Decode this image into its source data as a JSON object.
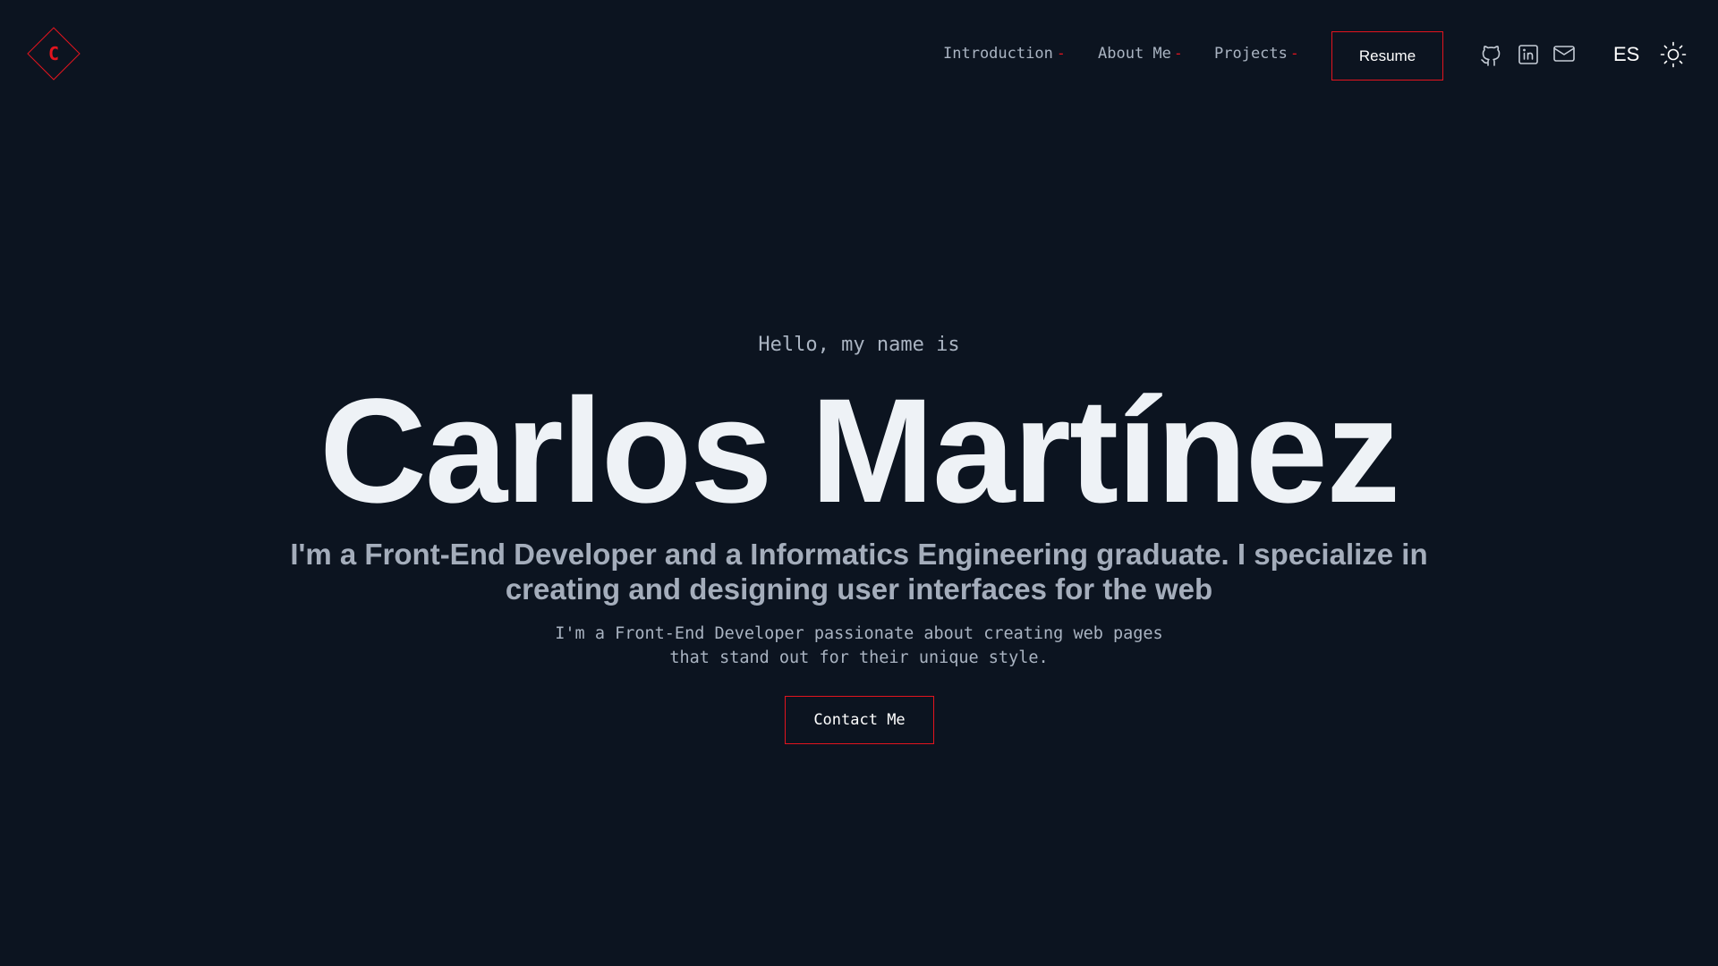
{
  "header": {
    "logo_letter": "C",
    "nav": [
      {
        "label": "Introduction"
      },
      {
        "label": "About Me"
      },
      {
        "label": "Projects"
      }
    ],
    "separator": "-",
    "resume_label": "Resume",
    "social_icons": [
      "github-icon",
      "linkedin-icon",
      "mail-icon"
    ],
    "language_label": "ES",
    "theme_icon": "sun-icon"
  },
  "hero": {
    "greeting": "Hello, my name is",
    "name": "Carlos Martínez",
    "tagline": "I'm a Front-End Developer and a Informatics Engineering graduate. I specialize in creating and designing user interfaces for the web",
    "description_line1": "I'm a Front-End Developer passionate about creating web pages",
    "description_line2": "that stand out for their unique style.",
    "contact_label": "Contact Me"
  },
  "colors": {
    "background": "#0c1420",
    "accent": "#e3141e",
    "text_primary": "#eef2f6",
    "text_muted": "#aab4c2"
  }
}
